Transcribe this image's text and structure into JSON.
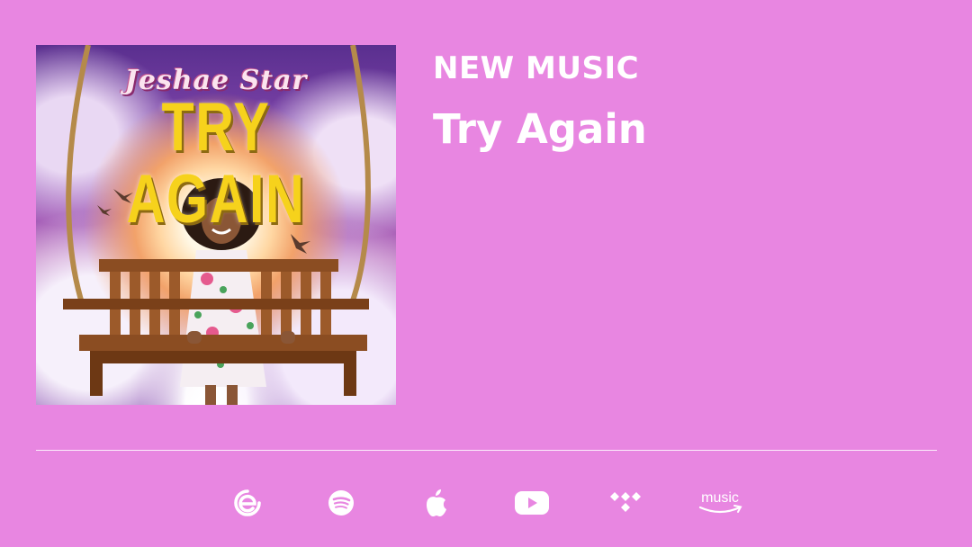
{
  "cover": {
    "artist_text": "Jeshae Star",
    "song_text": "TRY AGAIN"
  },
  "eyebrow": "NEW MUSIC",
  "title": "Try Again",
  "platforms": [
    {
      "name": "emusic-icon"
    },
    {
      "name": "spotify-icon"
    },
    {
      "name": "apple-icon"
    },
    {
      "name": "youtube-icon"
    },
    {
      "name": "tidal-icon"
    },
    {
      "name": "amazon-music-icon",
      "label": "music"
    }
  ],
  "colors": {
    "background": "#e886e1",
    "text": "#ffffff",
    "art_title_gold": "#f6d21c"
  }
}
